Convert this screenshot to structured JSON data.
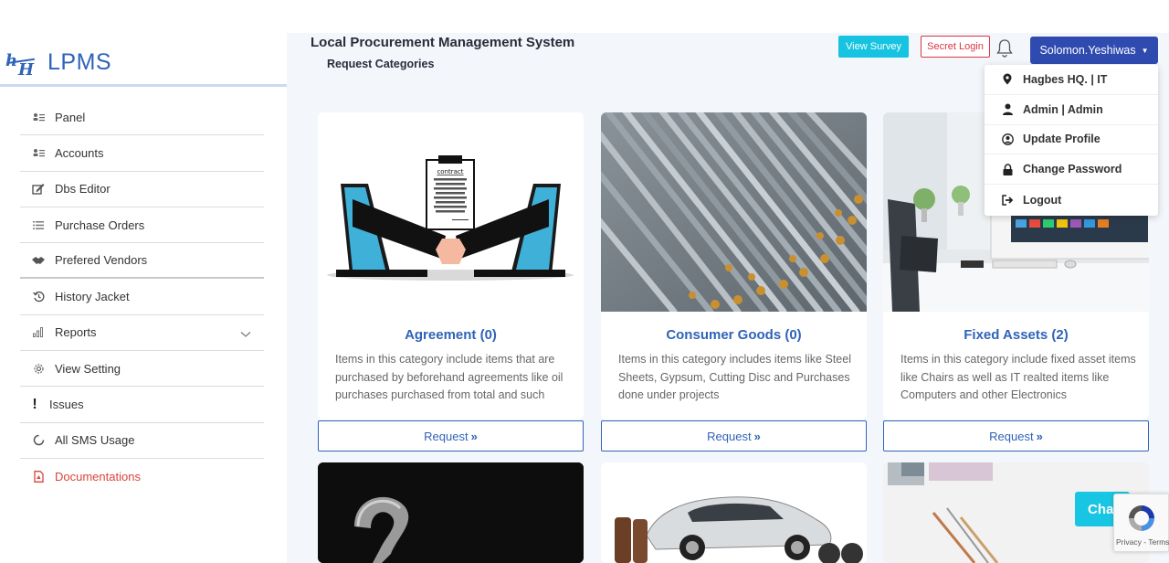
{
  "brand": {
    "name": "LPMS"
  },
  "header": {
    "title": "Local Procurement Management System",
    "subtitle": "Request Categories",
    "survey_label": "View Survey",
    "secret_label": "Secret Login",
    "user_label": "Solomon.Yeshiwas"
  },
  "user_menu": [
    {
      "label": "Hagbes HQ. | IT",
      "icon": "map-marker-icon"
    },
    {
      "label": "Admin | Admin",
      "icon": "user-icon"
    },
    {
      "label": "Update Profile",
      "icon": "user-circle-icon"
    },
    {
      "label": "Change Password",
      "icon": "lock-icon"
    },
    {
      "label": "Logout",
      "icon": "logout-icon"
    }
  ],
  "sidebar": {
    "items": [
      {
        "label": "Panel",
        "icon": "panel-icon"
      },
      {
        "label": "Accounts",
        "icon": "accounts-icon"
      },
      {
        "label": "Dbs Editor",
        "icon": "edit-icon"
      },
      {
        "label": "Purchase Orders",
        "icon": "list-icon"
      },
      {
        "label": "Prefered Vendors",
        "icon": "handshake-icon"
      },
      {
        "label": "History Jacket",
        "icon": "history-icon"
      },
      {
        "label": "Reports",
        "icon": "chart-icon"
      },
      {
        "label": "View Setting",
        "icon": "gear-icon"
      },
      {
        "label": "Issues",
        "icon": "exclamation-icon"
      },
      {
        "label": "All SMS Usage",
        "icon": "circle-icon"
      },
      {
        "label": "Documentations",
        "icon": "pdf-icon"
      }
    ]
  },
  "cards": [
    {
      "title": "Agreement (0)",
      "text": "Items in this category include items that are purchased by beforehand agreements like oil purchases purchased from total and such",
      "button": "Request",
      "image_label": "contract"
    },
    {
      "title": "Consumer Goods (0)",
      "text": "Items in this category includes items like Steel Sheets, Gypsum, Cutting Disc and Purchases done under projects",
      "button": "Request"
    },
    {
      "title": "Fixed Assets (2)",
      "text": "Items in this category include fixed asset items like Chairs as well as IT realted items like Computers and other Electronics",
      "button": "Request"
    }
  ],
  "chat": {
    "label": "Cha"
  },
  "recaptcha": {
    "text": "Privacy - Terms"
  },
  "colors": {
    "primary": "#2f63b8",
    "accent": "#16c3e0",
    "danger": "#dc3545",
    "user_button": "#2f4bb0"
  }
}
